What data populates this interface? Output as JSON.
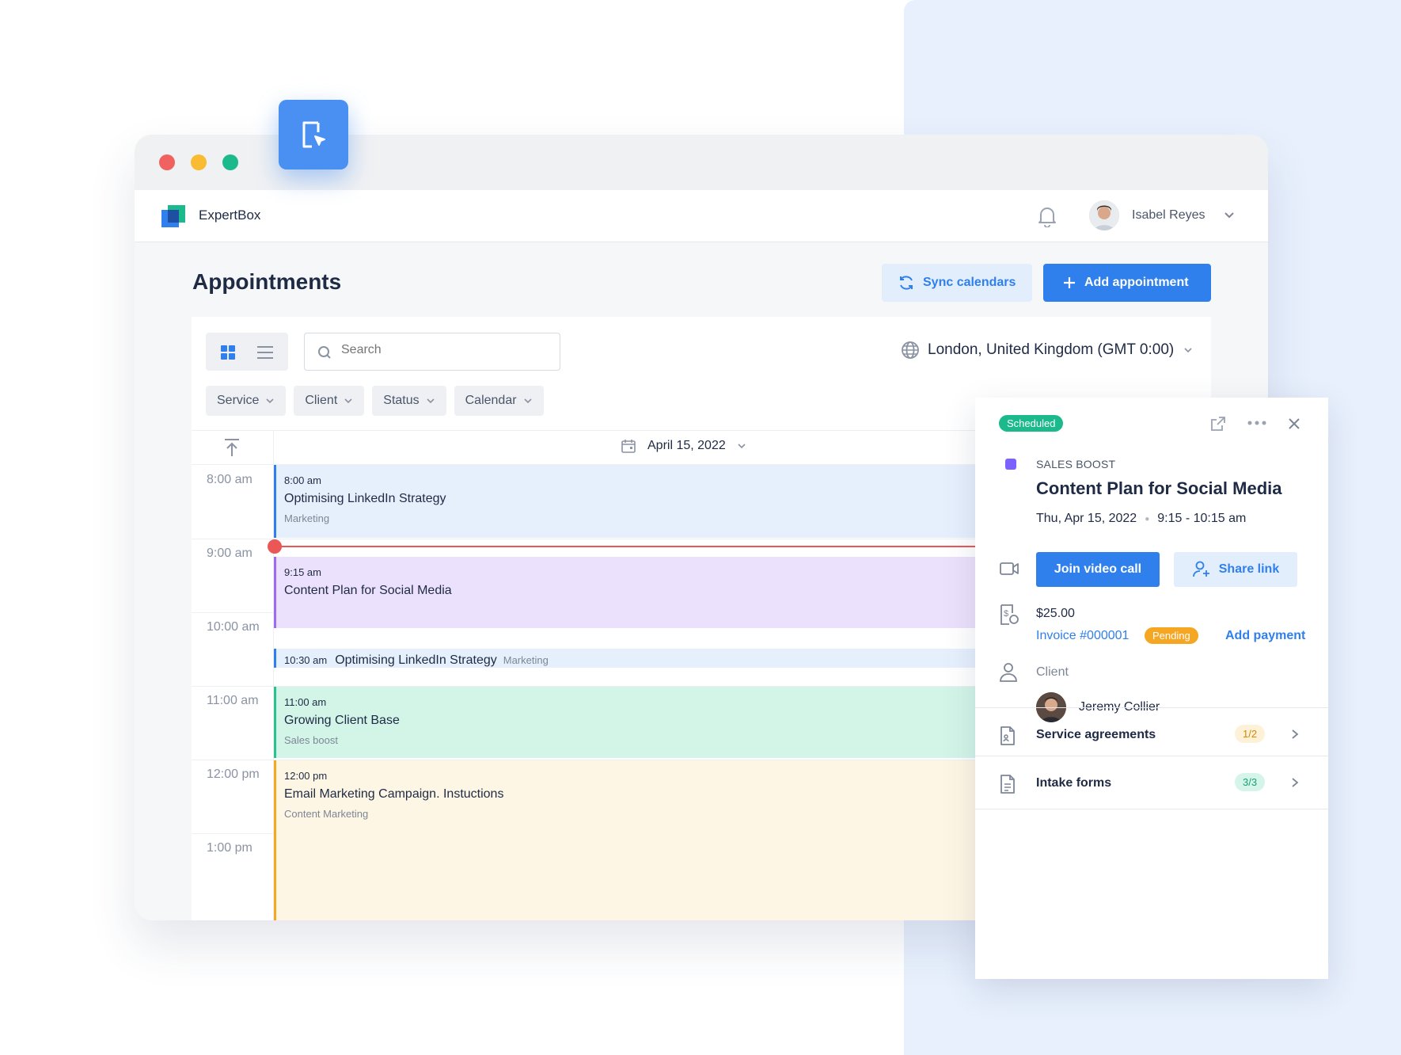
{
  "app": {
    "brand": "ExpertBox"
  },
  "user": {
    "name": "Isabel Reyes"
  },
  "page": {
    "title": "Appointments"
  },
  "actions": {
    "sync": "Sync calendars",
    "add": "Add appointment"
  },
  "toolbar": {
    "search_placeholder": "Search",
    "timezone": "London, United Kingdom (GMT 0:00)",
    "filters": [
      "Service",
      "Client",
      "Status",
      "Calendar"
    ]
  },
  "calendar": {
    "date": "April 15, 2022",
    "hours": [
      "8:00 am",
      "9:00 am",
      "10:00 am",
      "11:00 am",
      "12:00 pm",
      "1:00 pm"
    ],
    "events": [
      {
        "time": "8:00 am",
        "title": "Optimising LinkedIn Strategy",
        "category": "Marketing",
        "color": "#2f80ed"
      },
      {
        "time": "9:15 am",
        "title": "Content Plan for Social Media",
        "category": "",
        "color": "#9b6cf0"
      },
      {
        "time": "10:30 am",
        "title": "Optimising LinkedIn Strategy",
        "category": "Marketing",
        "color": "#2f80ed"
      },
      {
        "time": "11:00 am",
        "title": "Growing Client Base",
        "category": "Sales boost",
        "color": "#2bc08f"
      },
      {
        "time": "12:00 pm",
        "title": "Email Marketing Campaign. Instuctions",
        "category": "Content Marketing",
        "color": "#f5a623"
      }
    ]
  },
  "details": {
    "status": "Scheduled",
    "service": "SALES BOOST",
    "title": "Content Plan for Social Media",
    "date": "Thu, Apr 15, 2022",
    "time": "9:15 - 10:15 am",
    "join_label": "Join video call",
    "share_label": "Share link",
    "price": "$25.00",
    "invoice": "Invoice #000001",
    "payment_status": "Pending",
    "add_payment": "Add payment",
    "client_label": "Client",
    "client_name": "Jeremy Collier",
    "sections": [
      {
        "label": "Service agreements",
        "count": "1/2"
      },
      {
        "label": "Intake forms",
        "count": "3/3"
      }
    ]
  },
  "colors": {
    "accent": "#2f80ed",
    "scheduled": "#1cb98c",
    "pending": "#f5a623",
    "now_line": "#eb5757"
  }
}
